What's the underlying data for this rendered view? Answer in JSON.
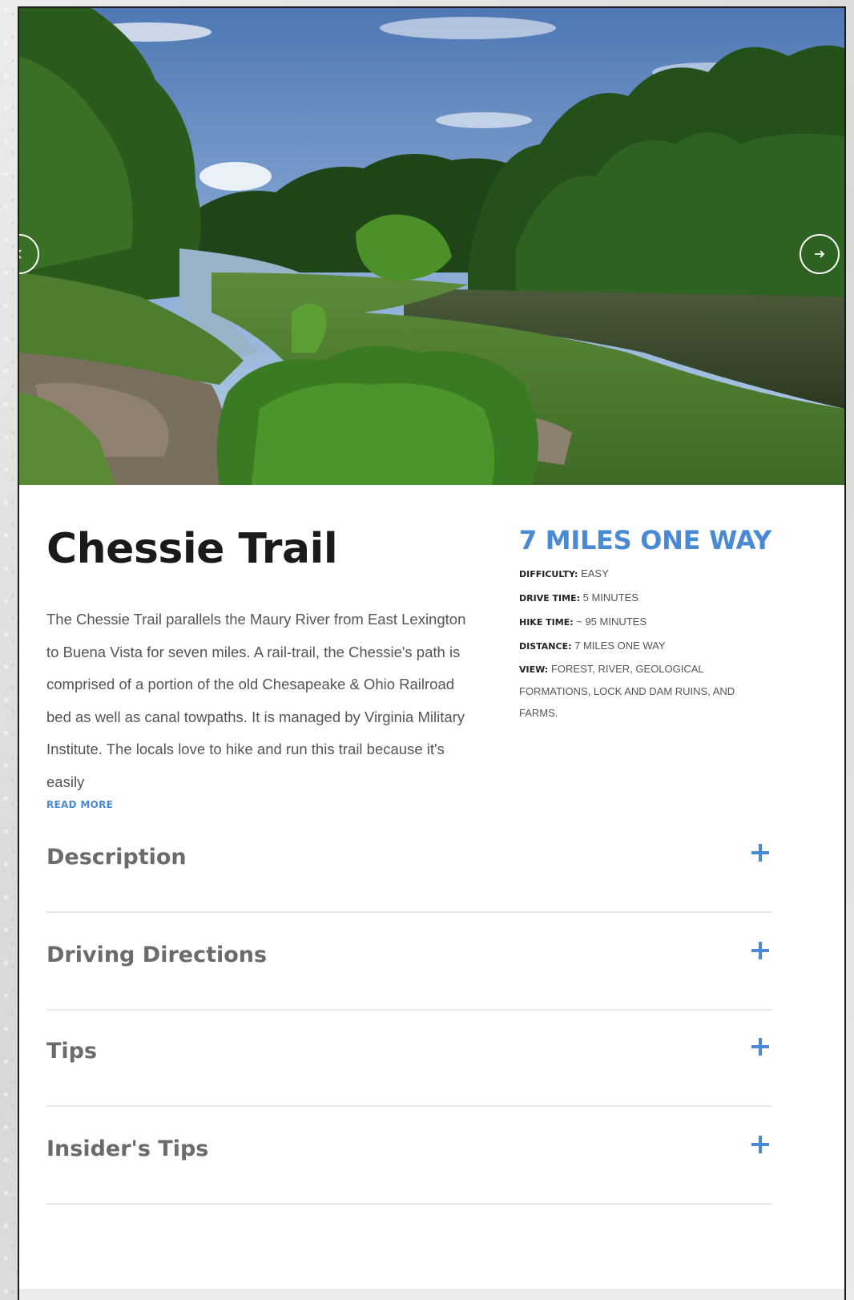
{
  "trail": {
    "title": "Chessie Trail",
    "description": "The Chessie Trail parallels the Maury River from East Lexington to Buena Vista for seven miles. A rail-trail, the Chessie's path is comprised of a portion of the old Chesapeake & Ohio Railroad bed as well as canal towpaths. It is managed by Virginia Military Institute. The locals love to hike and run this trail because it's easily",
    "read_more": "READ MORE"
  },
  "stats": {
    "headline": "7 MILES ONE WAY",
    "difficulty_label": "DIFFICULTY:",
    "difficulty_value": "EASY",
    "drive_label": "DRIVE TIME:",
    "drive_value": "5 MINUTES",
    "hike_label": "HIKE TIME:",
    "hike_value": "~ 95 MINUTES",
    "distance_label": "DISTANCE:",
    "distance_value": "7 MILES ONE WAY",
    "view_label": "VIEW:",
    "view_value": "FOREST, RIVER, GEOLOGICAL FORMATIONS, LOCK AND DAM RUINS, AND FARMS."
  },
  "accordion": [
    {
      "label": "Description"
    },
    {
      "label": "Driving Directions"
    },
    {
      "label": "Tips"
    },
    {
      "label": "Insider's Tips"
    }
  ],
  "icons": {
    "next": "chevron-right-icon",
    "prev": "chevron-left-icon",
    "expand": "plus-icon"
  },
  "colors": {
    "accent": "#4a8ad4",
    "heading": "#1a1a1a",
    "accordion_label": "#6b6b6b"
  }
}
